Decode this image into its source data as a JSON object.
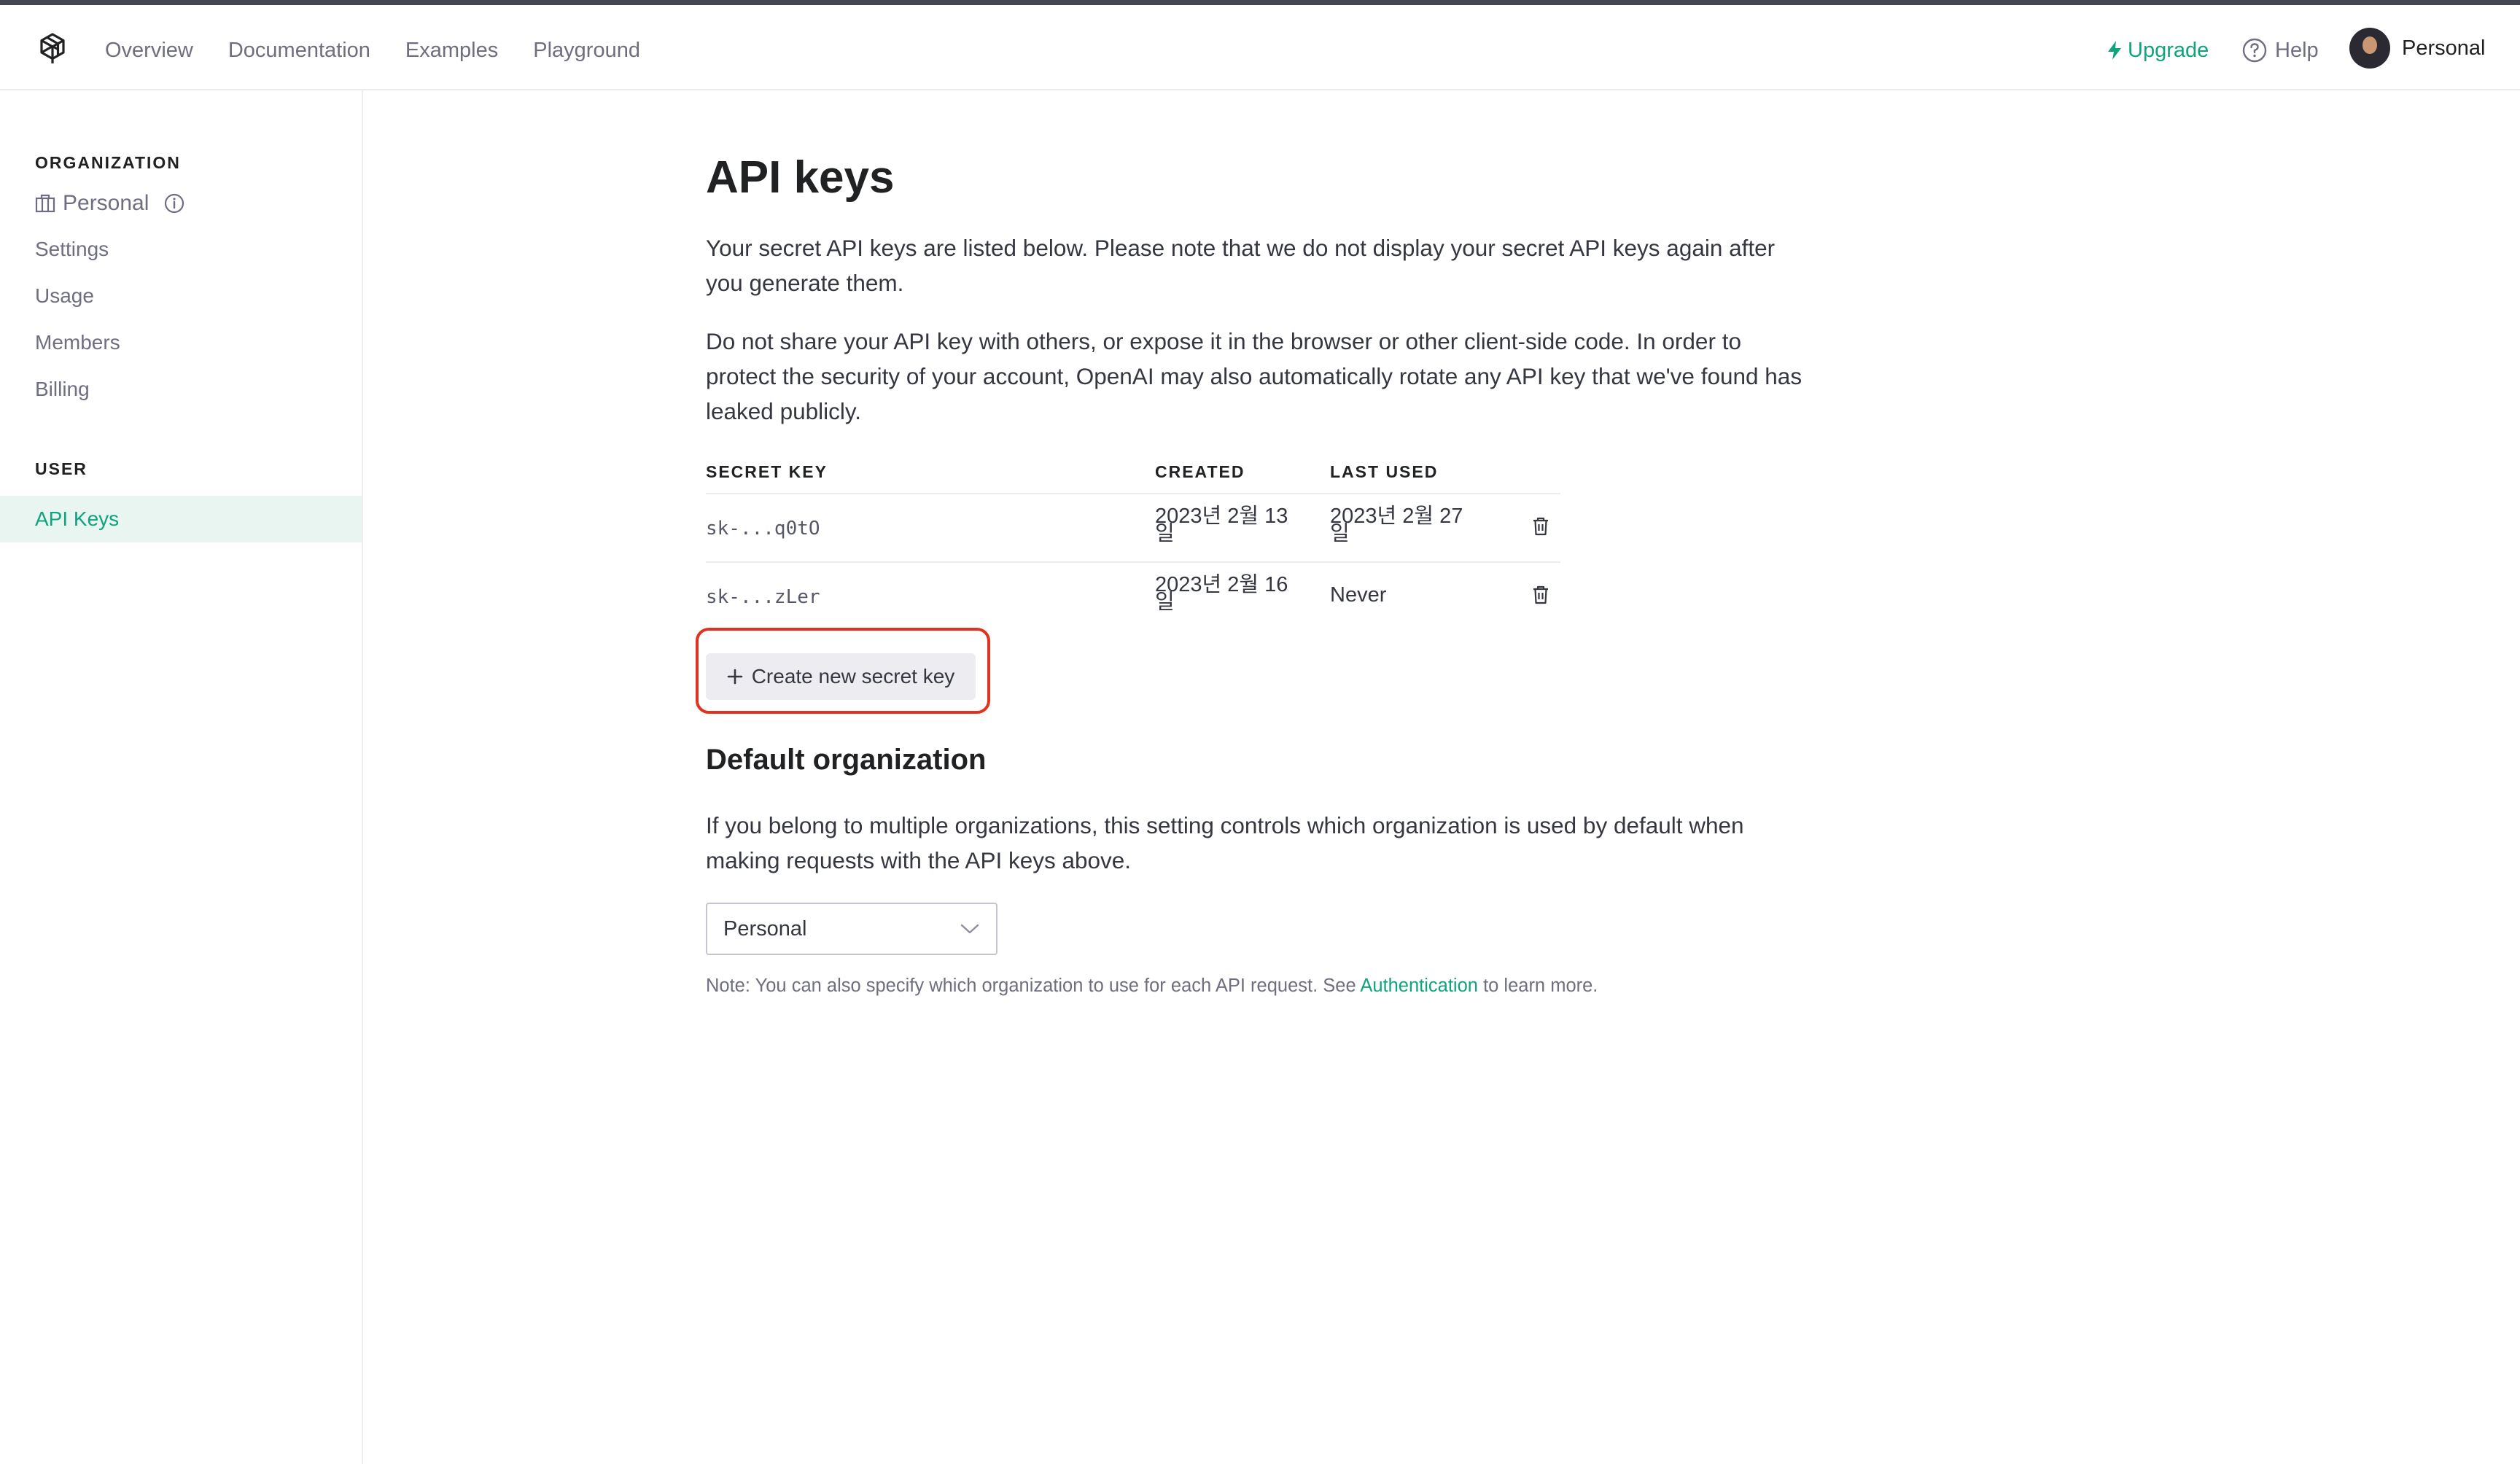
{
  "nav": {
    "links": [
      "Overview",
      "Documentation",
      "Examples",
      "Playground"
    ],
    "upgrade": "Upgrade",
    "help": "Help",
    "account": "Personal"
  },
  "sidebar": {
    "org_heading": "ORGANIZATION",
    "org_name": "Personal",
    "items": [
      "Settings",
      "Usage",
      "Members",
      "Billing"
    ],
    "user_heading": "USER",
    "active_item": "API Keys"
  },
  "main": {
    "title": "API keys",
    "intro": "Your secret API keys are listed below. Please note that we do not display your secret API keys again after you generate them.",
    "warning": "Do not share your API key with others, or expose it in the browser or other client-side code. In order to protect the security of your account, OpenAI may also automatically rotate any API key that we've found has leaked publicly.",
    "table": {
      "headers": [
        "SECRET KEY",
        "CREATED",
        "LAST USED"
      ],
      "rows": [
        {
          "key": "sk-...q0tO",
          "created": "2023년 2월 13일",
          "last_used": "2023년 2월 27일"
        },
        {
          "key": "sk-...zLer",
          "created": "2023년 2월 16일",
          "last_used": "Never"
        }
      ]
    },
    "create_button": "Create new secret key",
    "default_org": {
      "title": "Default organization",
      "description": "If you belong to multiple organizations, this setting controls which organization is used by default when making requests with the API keys above.",
      "selected": "Personal",
      "note_prefix": "Note: You can also specify which organization to use for each API request. See",
      "note_link": "Authentication",
      "note_suffix": "to learn more."
    }
  },
  "colors": {
    "accent": "#10a37f",
    "highlight": "#e0321f",
    "active_bg": "#e8f5f1"
  }
}
